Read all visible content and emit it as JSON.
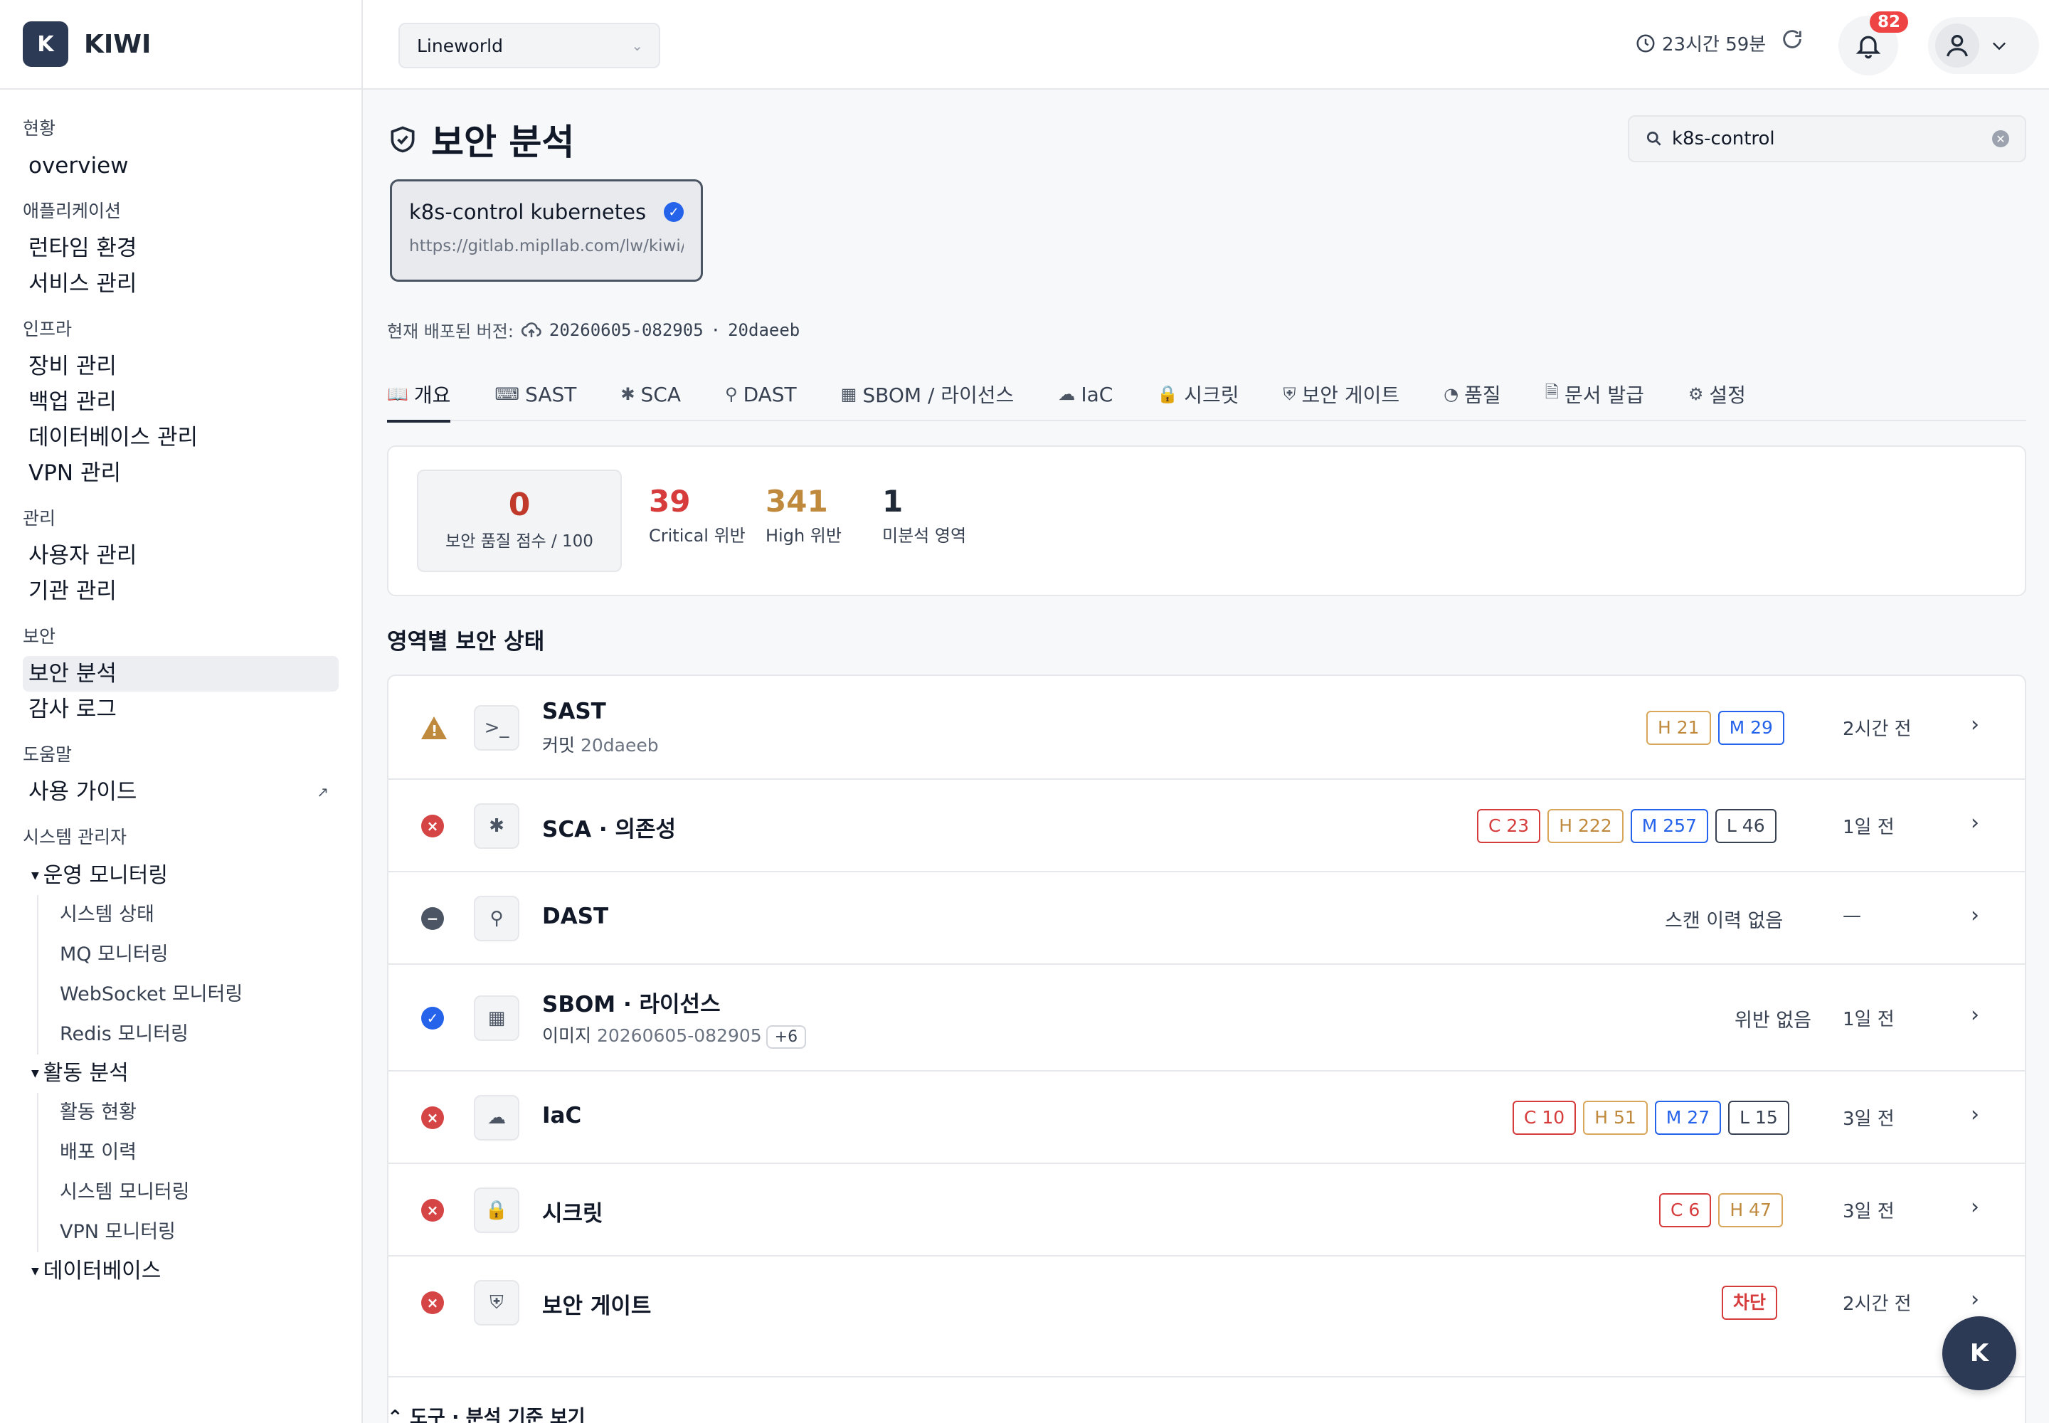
{
  "brand": {
    "logo_letter": "K",
    "name": "KIWI"
  },
  "sidebar": {
    "sections": [
      {
        "title": "현황",
        "items": [
          {
            "label": "overview"
          }
        ]
      },
      {
        "title": "애플리케이션",
        "items": [
          {
            "label": "런타임 환경"
          },
          {
            "label": "서비스 관리"
          }
        ]
      },
      {
        "title": "인프라",
        "items": [
          {
            "label": "장비 관리"
          },
          {
            "label": "백업 관리"
          },
          {
            "label": "데이터베이스 관리"
          },
          {
            "label": "VPN 관리"
          }
        ]
      },
      {
        "title": "관리",
        "items": [
          {
            "label": "사용자 관리"
          },
          {
            "label": "기관 관리"
          }
        ]
      },
      {
        "title": "보안",
        "items": [
          {
            "label": "보안 분석"
          },
          {
            "label": "감사 로그"
          }
        ]
      },
      {
        "title": "도움말",
        "items": [
          {
            "label": "사용 가이드"
          }
        ]
      }
    ],
    "admin": {
      "title": "시스템 관리자",
      "groups": [
        {
          "title": "운영 모니터링",
          "items": [
            "시스템 상태",
            "MQ 모니터링",
            "WebSocket 모니터링",
            "Redis 모니터링"
          ]
        },
        {
          "title": "활동 분석",
          "items": [
            "활동 현황",
            "배포 이력",
            "시스템 모니터링",
            "VPN 모니터링"
          ]
        },
        {
          "title": "데이터베이스",
          "items": []
        }
      ]
    }
  },
  "topbar": {
    "project": "Lineworld",
    "session_time": "23시간 59분",
    "notification_count": "82"
  },
  "page": {
    "title": "보안 분석",
    "search_value": "k8s-control",
    "repo": {
      "name": "k8s-control kubernetes",
      "url": "https://gitlab.mipllab.com/lw/kiwi/..."
    },
    "deploy_label": "현재 배포된 버전:",
    "deploy_version": "20260605-082905",
    "deploy_sep": "·",
    "deploy_commit": "20daeeb"
  },
  "tabs": [
    {
      "label": "개요",
      "icon": "book-icon"
    },
    {
      "label": "SAST",
      "icon": "terminal-icon"
    },
    {
      "label": "SCA",
      "icon": "bug-icon"
    },
    {
      "label": "DAST",
      "icon": "syringe-icon"
    },
    {
      "label": "SBOM / 라이선스",
      "icon": "grid-icon"
    },
    {
      "label": "IaC",
      "icon": "cloud-icon"
    },
    {
      "label": "시크릿",
      "icon": "lock-icon"
    },
    {
      "label": "보안 게이트",
      "icon": "shield-icon"
    },
    {
      "label": "품질",
      "icon": "gauge-icon"
    },
    {
      "label": "문서 발급",
      "icon": "document-icon"
    },
    {
      "label": "설정",
      "icon": "gear-icon"
    }
  ],
  "stats": {
    "score": {
      "value": "0",
      "label": "보안 품질 점수 / 100"
    },
    "critical": {
      "value": "39",
      "label": "Critical 위반"
    },
    "high": {
      "value": "341",
      "label": "High 위반"
    },
    "unanalyzed": {
      "value": "1",
      "label": "미분석 영역"
    }
  },
  "areas_title": "영역별 보안 상태",
  "areas": [
    {
      "status": "warning",
      "icon": "terminal-icon",
      "name": "SAST",
      "sub_label": "커밋",
      "sub_value": "20daeeb",
      "pills": [
        {
          "label": "H 21",
          "kind": "h"
        },
        {
          "label": "M 29",
          "kind": "m"
        }
      ],
      "when": "2시간 전"
    },
    {
      "status": "error",
      "icon": "bug-icon",
      "name": "SCA · 의존성",
      "pills": [
        {
          "label": "C 23",
          "kind": "c"
        },
        {
          "label": "H 222",
          "kind": "h"
        },
        {
          "label": "M 257",
          "kind": "m"
        },
        {
          "label": "L 46",
          "kind": "l"
        }
      ],
      "when": "1일 전"
    },
    {
      "status": "none",
      "icon": "syringe-icon",
      "name": "DAST",
      "note": "스캔 이력 없음",
      "when": "—"
    },
    {
      "status": "ok",
      "icon": "grid-icon",
      "name": "SBOM · 라이선스",
      "sub_label": "이미지",
      "sub_value": "20260605-082905",
      "sub_chip": "+6",
      "note": "위반 없음",
      "when": "1일 전"
    },
    {
      "status": "error",
      "icon": "cloud-icon",
      "name": "IaC",
      "pills": [
        {
          "label": "C 10",
          "kind": "c"
        },
        {
          "label": "H 51",
          "kind": "h"
        },
        {
          "label": "M 27",
          "kind": "m"
        },
        {
          "label": "L 15",
          "kind": "l"
        }
      ],
      "when": "3일 전"
    },
    {
      "status": "error",
      "icon": "lock-icon",
      "name": "시크릿",
      "pills": [
        {
          "label": "C 6",
          "kind": "c"
        },
        {
          "label": "H 47",
          "kind": "h"
        }
      ],
      "when": "3일 전"
    },
    {
      "status": "error",
      "icon": "shield-icon",
      "name": "보안 게이트",
      "pills": [
        {
          "label": "차단",
          "kind": "block"
        }
      ],
      "when": "2시간 전"
    }
  ],
  "tools_toggle": "도구 · 분석 기준 보기",
  "fab_letter": "K",
  "colors": {
    "brand": "#2d3a55",
    "critical": "#d63c3c",
    "high": "#c08a3e",
    "medium": "#2563eb",
    "low": "#374151"
  }
}
